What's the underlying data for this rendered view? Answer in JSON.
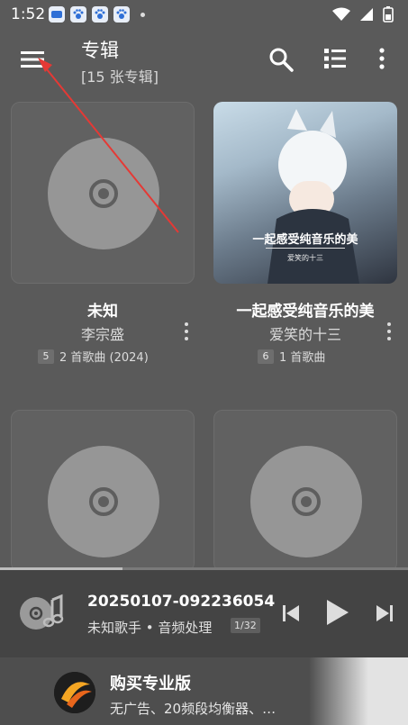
{
  "status_bar": {
    "time": "1:52"
  },
  "toolbar": {
    "title": "专辑",
    "subtitle": "[15 张专辑]"
  },
  "albums": [
    {
      "title": "未知",
      "artist": "李宗盛",
      "track_badge": "5",
      "meta": "2 首歌曲 (2024)"
    },
    {
      "title": "一起感受纯音乐的美",
      "artist": "爱笑的十三",
      "track_badge": "6",
      "meta": "1 首歌曲",
      "art_text": "一起感受纯音乐的美",
      "art_subtext": "爱笑的十三"
    },
    {
      "title": "",
      "artist": ""
    },
    {
      "title": "",
      "artist": ""
    }
  ],
  "player": {
    "track_name": "20250107-092236054",
    "subtitle": "未知歌手 • 音频处理",
    "count": "1/32",
    "progress": 0.3
  },
  "promo": {
    "title": "购买专业版",
    "description": "无广告、20频段均衡器、…"
  },
  "colors": {
    "accent_arrow": "#e53935",
    "background": "#5a5a5a",
    "player_bg": "#444444"
  }
}
